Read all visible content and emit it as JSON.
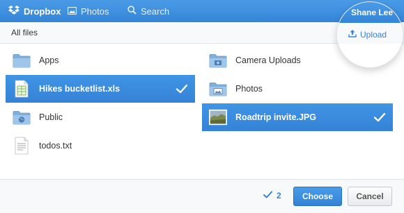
{
  "topbar": {
    "dropbox_label": "Dropbox",
    "photos_label": "Photos",
    "search_label": "Search",
    "user_name": "Shane Lee"
  },
  "subheader": {
    "breadcrumb": "All files",
    "upload_label": "Upload"
  },
  "files": [
    {
      "name": "Apps",
      "icon": "folder-icon",
      "selected": false
    },
    {
      "name": "Camera Uploads",
      "icon": "camera-folder-icon",
      "selected": false
    },
    {
      "name": "Hikes bucketlist.xls",
      "icon": "spreadsheet-icon",
      "selected": true
    },
    {
      "name": "Photos",
      "icon": "photos-folder-icon",
      "selected": false
    },
    {
      "name": "Public",
      "icon": "public-folder-icon",
      "selected": false
    },
    {
      "name": "Roadtrip invite.JPG",
      "icon": "image-thumbnail",
      "selected": true
    },
    {
      "name": "todos.txt",
      "icon": "text-file-icon",
      "selected": false
    }
  ],
  "footer": {
    "selected_count": "2",
    "choose_label": "Choose",
    "cancel_label": "Cancel"
  },
  "colors": {
    "accent": "#3b8ee0",
    "link": "#3583d6"
  }
}
